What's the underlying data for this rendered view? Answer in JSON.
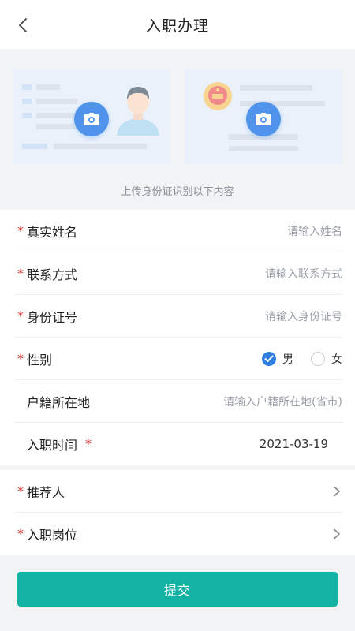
{
  "header": {
    "title": "入职办理"
  },
  "upload": {
    "hint": "上传身份证识别以下内容"
  },
  "form": {
    "name": {
      "label": "真实姓名",
      "placeholder": "请输入姓名"
    },
    "contact": {
      "label": "联系方式",
      "placeholder": "请输入联系方式"
    },
    "id_number": {
      "label": "身份证号",
      "placeholder": "请输入身份证号"
    },
    "gender": {
      "label": "性别",
      "options": [
        "男",
        "女"
      ],
      "selected": "男"
    },
    "household": {
      "label": "户籍所在地",
      "placeholder": "请输入户籍所在地(省市)"
    },
    "entry_time": {
      "label": "入职时间",
      "value": "2021-03-19"
    },
    "referrer": {
      "label": "推荐人"
    },
    "position": {
      "label": "入职岗位"
    },
    "required_mark": "*"
  },
  "submit": {
    "label": "提交"
  },
  "colors": {
    "accent": "#13b2a3",
    "required": "#e02d2d",
    "camera": "#4f94ea",
    "checked": "#2f7ee0"
  },
  "icons": [
    "back-arrow-icon",
    "camera-icon",
    "person-avatar-icon",
    "national-emblem-icon",
    "check-icon",
    "chevron-right-icon"
  ]
}
